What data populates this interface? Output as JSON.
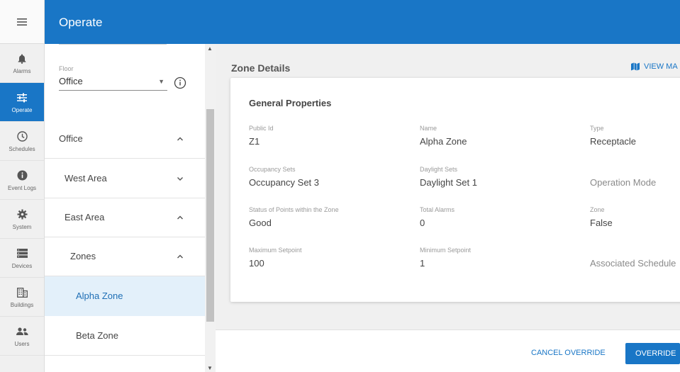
{
  "header": {
    "title": "Operate"
  },
  "rail": {
    "items": [
      {
        "label": "Alarms",
        "icon": "bell-icon"
      },
      {
        "label": "Operate",
        "icon": "sliders-icon",
        "active": true
      },
      {
        "label": "Schedules",
        "icon": "clock-icon"
      },
      {
        "label": "Event Logs",
        "icon": "info-icon"
      },
      {
        "label": "System",
        "icon": "gear-icon"
      },
      {
        "label": "Devices",
        "icon": "devices-icon"
      },
      {
        "label": "Buildings",
        "icon": "building-icon"
      },
      {
        "label": "Users",
        "icon": "users-icon"
      }
    ]
  },
  "tree": {
    "floor_label": "Floor",
    "floor_value": "Office",
    "rows": [
      {
        "label": "Office",
        "expanded": true
      },
      {
        "label": "West Area",
        "expanded": false
      },
      {
        "label": "East Area",
        "expanded": true
      },
      {
        "label": "Zones",
        "expanded": true
      },
      {
        "label": "Alpha Zone",
        "selected": true
      },
      {
        "label": "Beta Zone"
      }
    ]
  },
  "main": {
    "title": "Zone Details",
    "view_map": "VIEW MA",
    "card_title": "General Properties",
    "props": {
      "public_id": {
        "key": "Public Id",
        "value": "Z1"
      },
      "name": {
        "key": "Name",
        "value": "Alpha Zone"
      },
      "type": {
        "key": "Type",
        "value": "Receptacle"
      },
      "occupancy_sets": {
        "key": "Occupancy Sets",
        "value": "Occupancy Set 3"
      },
      "daylight_sets": {
        "key": "Daylight Sets",
        "value": "Daylight Set 1"
      },
      "operation_mode": {
        "value": "Operation Mode"
      },
      "status_points": {
        "key": "Status of Points within the Zone",
        "value": "Good"
      },
      "total_alarms": {
        "key": "Total Alarms",
        "value": "0"
      },
      "zone": {
        "key": "Zone",
        "value": "False"
      },
      "max_setpoint": {
        "key": "Maximum Setpoint",
        "value": "100"
      },
      "min_setpoint": {
        "key": "Minimum Setpoint",
        "value": "1"
      },
      "associated_schedule": {
        "value": "Associated Schedule"
      }
    }
  },
  "footer": {
    "cancel": "CANCEL OVERRIDE",
    "override": "OVERRIDE"
  },
  "colors": {
    "primary": "#1976c6",
    "selected_bg": "#e3f0fa",
    "rail_bg": "#f0f0f0"
  }
}
